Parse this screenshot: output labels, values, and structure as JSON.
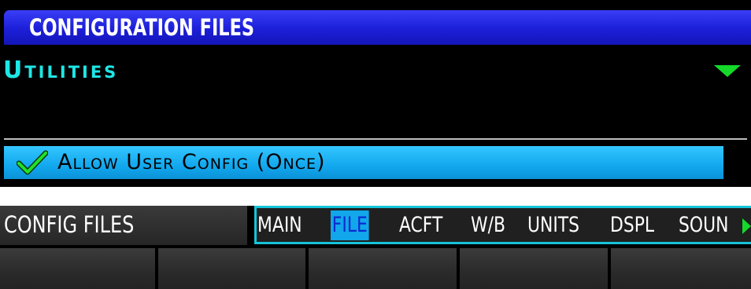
{
  "panel": {
    "title": "CONFIGURATION FILES",
    "section_label": "Utilities",
    "option_label": "Allow User Config (Once)",
    "option_checked": true
  },
  "footer": {
    "page_name": "CONFIG FILES",
    "tabs": [
      {
        "label": "MAIN",
        "active": false
      },
      {
        "label": "FILE",
        "active": true
      },
      {
        "label": "ACFT",
        "active": false
      },
      {
        "label": "W/B",
        "active": false
      },
      {
        "label": "UNITS",
        "active": false
      },
      {
        "label": "DSPL",
        "active": false
      },
      {
        "label": "SOUN",
        "active": false
      }
    ],
    "softkeys": [
      "",
      "",
      "",
      "",
      ""
    ]
  },
  "colors": {
    "title_bar": "#1c1fd8",
    "section_text": "#1ee6e6",
    "selection": "#12a8ee",
    "indicator_green": "#15d82b",
    "tab_border": "#15c4da"
  },
  "icons": {
    "check": "check-icon",
    "dropdown": "dropdown-arrow-icon",
    "more_tabs": "more-tabs-arrow-icon"
  }
}
